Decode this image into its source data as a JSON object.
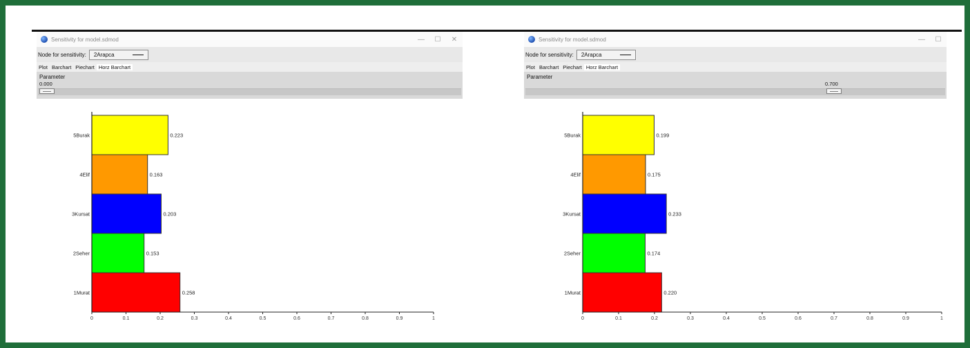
{
  "windows": [
    {
      "title": "Sensitivity for model.sdmod",
      "node_label": "Node for sensitivity:",
      "node_value": "2Arapca",
      "tabs": [
        "Plot",
        "Barchart",
        "Piechart",
        "Horz Barchart"
      ],
      "active_tab": 3,
      "parameter_label": "Parameter",
      "parameter_value": "0.000",
      "parameter_level": 0.0,
      "chart_data": {
        "type": "bar",
        "orientation": "horizontal",
        "categories": [
          "5Burak",
          "4Elif",
          "3Kursat",
          "2Seher",
          "1Murat"
        ],
        "values": [
          0.223,
          0.163,
          0.203,
          0.153,
          0.258
        ],
        "value_labels": [
          "0.223",
          "0.163",
          "0.203",
          "0.153",
          "0.258"
        ],
        "colors": [
          "#ffff00",
          "#ff9900",
          "#0000ff",
          "#00ff00",
          "#ff0000"
        ],
        "xlim": [
          0,
          1
        ],
        "xticks": [
          "0",
          "0.1",
          "0.2",
          "0.3",
          "0.4",
          "0.5",
          "0.6",
          "0.7",
          "0.8",
          "0.9",
          "1"
        ]
      }
    },
    {
      "title": "Sensitivity for model.sdmod",
      "node_label": "Node for sensitivity:",
      "node_value": "2Arapca",
      "tabs": [
        "Plot",
        "Barchart",
        "Piechart",
        "Horz Barchart"
      ],
      "active_tab": 3,
      "parameter_label": "Parameter",
      "parameter_value": "0.700",
      "parameter_level": 0.7,
      "chart_data": {
        "type": "bar",
        "orientation": "horizontal",
        "categories": [
          "5Burak",
          "4Elif",
          "3Kursat",
          "2Seher",
          "1Murat"
        ],
        "values": [
          0.199,
          0.175,
          0.233,
          0.174,
          0.22
        ],
        "value_labels": [
          "0.199",
          "0.175",
          "0.233",
          "0.174",
          "0.220"
        ],
        "colors": [
          "#ffff00",
          "#ff9900",
          "#0000ff",
          "#00ff00",
          "#ff0000"
        ],
        "xlim": [
          0,
          1
        ],
        "xticks": [
          "0",
          "0.1",
          "0.2",
          "0.3",
          "0.4",
          "0.5",
          "0.6",
          "0.7",
          "0.8",
          "0.9",
          "1"
        ]
      }
    }
  ]
}
